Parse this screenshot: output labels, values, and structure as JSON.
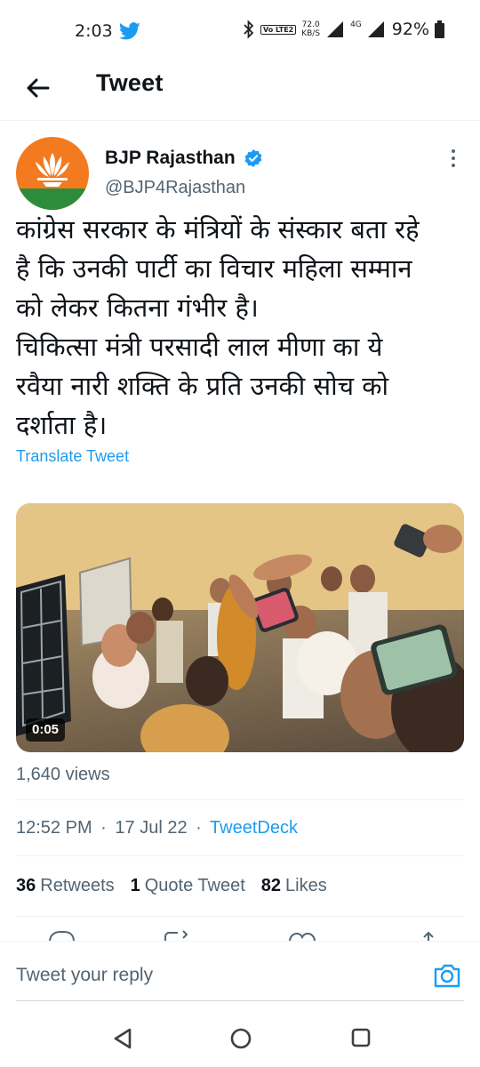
{
  "status_bar": {
    "time": "2:03",
    "volte": "Vo LTE2",
    "net_speed": "72.0",
    "net_speed_unit": "KB/S",
    "network": "4G",
    "battery": "92%"
  },
  "header": {
    "title": "Tweet"
  },
  "tweet": {
    "author_name": "BJP Rajasthan",
    "author_handle": "@BJP4Rajasthan",
    "text": "कांग्रेस सरकार के मंत्रियों के संस्कार बता रहे\nहै कि उनकी पार्टी का विचार महिला सम्मान\nको लेकर कितना गंभीर है।\nचिकित्सा मंत्री परसादी लाल मीणा का ये\nरवैया नारी शक्ति के प्रति उनकी सोच को\nदर्शाता है।",
    "translate_label": "Translate Tweet",
    "video_duration": "0:05",
    "views": "1,640 views",
    "time": "12:52 PM",
    "separator": "·",
    "date": "17 Jul 22",
    "source": "TweetDeck",
    "retweets_count": "36",
    "retweets_label": "Retweets",
    "quotes_count": "1",
    "quotes_label": "Quote Tweet",
    "likes_count": "82",
    "likes_label": "Likes"
  },
  "reply": {
    "placeholder": "Tweet your reply"
  },
  "colors": {
    "accent": "#1d9bf0",
    "text": "#0f1419",
    "secondary": "#536471"
  },
  "icons": [
    "twitter-icon",
    "bluetooth-icon",
    "signal-icon",
    "battery-icon",
    "back-arrow-icon",
    "verified-icon",
    "more-icon",
    "camera-icon",
    "nav-back-icon",
    "nav-home-icon",
    "nav-recents-icon"
  ]
}
